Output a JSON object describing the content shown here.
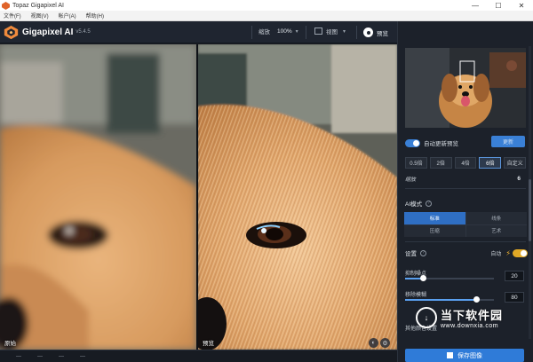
{
  "window": {
    "title": "Topaz Gigapixel AI",
    "controls": [
      "—",
      "☐",
      "✕"
    ]
  },
  "menu": {
    "items": [
      "文件(F)",
      "视图(V)",
      "帐户(A)",
      "帮助(H)"
    ]
  },
  "toolbar": {
    "app_name": "Gigapixel AI",
    "version": "v5.4.5",
    "zoom_label": "缩放",
    "zoom_value": "100%",
    "view_label": "视图",
    "preview_label": "预览"
  },
  "panes": {
    "left_label": "原始",
    "right_label": "预览"
  },
  "statusbar": {
    "items": [
      "—",
      "—",
      "—",
      "—"
    ]
  },
  "sidebar": {
    "auto_update_label": "自动更新预览",
    "update_button": "更新",
    "scale_options": [
      {
        "label": "0.5倍",
        "active": false
      },
      {
        "label": "2倍",
        "active": false
      },
      {
        "label": "4倍",
        "active": false
      },
      {
        "label": "6倍",
        "active": true
      },
      {
        "label": "自定义",
        "active": false
      }
    ],
    "scale_label": "缩放",
    "scale_value": "6",
    "ai_mode_title": "AI模式",
    "modes": [
      {
        "label": "标准",
        "active": true
      },
      {
        "label": "线条",
        "active": false
      },
      {
        "label": "压缩",
        "active": false
      },
      {
        "label": "艺术",
        "active": false
      }
    ],
    "settings_title": "设置",
    "settings_auto": "自动",
    "settings_auto_on": true,
    "suppress_noise_label": "抑制噪点",
    "suppress_noise_value": "20",
    "remove_blur_label": "移除模糊",
    "remove_blur_value": "80",
    "color_label": "其他颜色设置",
    "save_button": "保存图像"
  },
  "watermark": {
    "main": "当下软件园",
    "sub": "www.downxia.com"
  },
  "colors": {
    "accent": "#2f7bd8",
    "toggle_on": "#3a80d6",
    "auto_gold": "#e0a826",
    "panel_bg": "#1c212a"
  }
}
